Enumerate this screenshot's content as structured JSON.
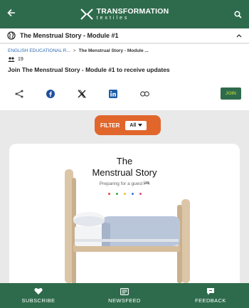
{
  "appbar": {
    "logo_line1": "TRANSFORMATION",
    "logo_line2": "textiles"
  },
  "group": {
    "title": "The Menstrual Story - Module #1",
    "breadcrumb_parent": "ENGLISH EDUCATIONAL R...",
    "breadcrumb_sep": ">",
    "breadcrumb_current": "The Menstrual Story - Module ...",
    "member_count": "19",
    "join_prompt": "Join The Menstrual Story - Module #1 to receive updates",
    "join_button": "JOIN"
  },
  "filter": {
    "label": "FILTER",
    "selected": "All"
  },
  "card": {
    "title_line1": "The",
    "title_line2": "Menstrual Story",
    "subtitle": "Preparing for a guest",
    "dot_colors": [
      "#e04b3c",
      "#3aa64f",
      "#e8c23a",
      "#3a6fd8",
      "#d84a86"
    ]
  },
  "bottom_nav": {
    "subscribe": "SUBSCRIBE",
    "newsfeed": "NEWSFEED",
    "feedback": "FEEDBACK"
  },
  "colors": {
    "brand_green": "#2e6b4c",
    "accent_orange": "#e0662c",
    "join_text": "#a6c13a"
  }
}
